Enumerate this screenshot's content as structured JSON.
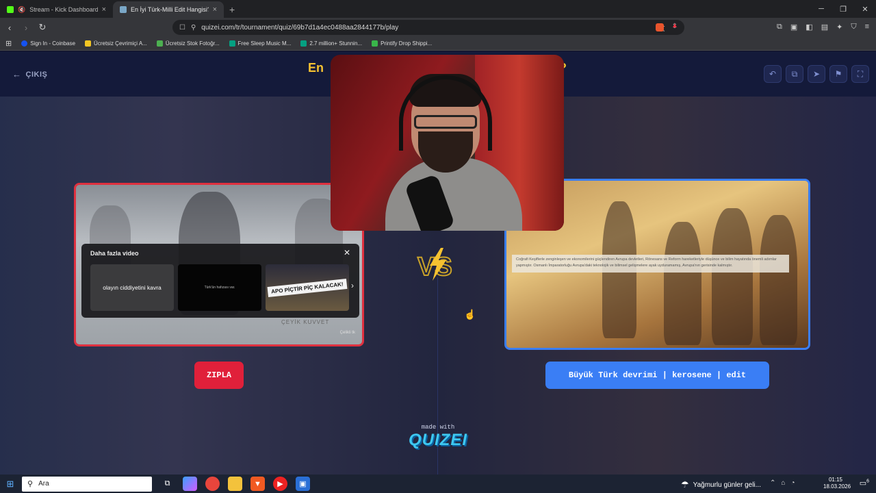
{
  "browser": {
    "tabs": [
      {
        "title": "Stream - Kick Dashboard",
        "favicon_color": "#53fc18"
      },
      {
        "title": "En İyi Türk-Milli Edit Hangisi? - T",
        "favicon_color": "#7aa7c7"
      }
    ],
    "url": "quizei.com/tr/tournament/quiz/69b7d1a4ec0488aa2844177b/play",
    "bookmarks": [
      {
        "label": "Sign In - Coinbase",
        "color": "#1652f0"
      },
      {
        "label": "Ücretsiz Çevrimiçi A...",
        "color": "#f3c623"
      },
      {
        "label": "Ücretsiz Stok Fotoğr...",
        "color": "#4cb050"
      },
      {
        "label": "Free Sleep Music M...",
        "color": "#05a081"
      },
      {
        "label": "2.7 million+ Stunnin...",
        "color": "#05a081"
      },
      {
        "label": "Printify Drop Shippi...",
        "color": "#39b54a"
      }
    ]
  },
  "page": {
    "exit_label": "ÇIKIŞ",
    "title_start": "En",
    "title_end": "?",
    "left_card": {
      "more_videos_title": "Daha fazla video",
      "thumbs": [
        "olayın ciddiyetini kavra",
        "Türk'ün hafızası var.",
        "APO PİÇTİR PİÇ KALACAK!"
      ],
      "bottom_text": "ÇEYİK KUVVET",
      "watermark": "Çelikli tk"
    },
    "right_card": {
      "subtitle": "Coğrafi Keşiflerle zenginleşen ve ekonomilerini güçlendiren Avrupa devletleri, Rönesans ve Reform hareketleriyle düşünce ve bilim hayatında önemli adımlar yapmıştır. Osmanlı İmparatorluğu Avrupa'daki teknolojik ve bilimsel gelişmelere ayak uyduramamış, Avrupa'nın gerisinde kalmıştır."
    },
    "skip_label": "ZIPLA",
    "pick_label": "Büyük Türk devrimi | kerosene | edit",
    "made_with": "made with",
    "brand": "QUIZEI",
    "colors": {
      "accent_red": "#e0203a",
      "accent_blue": "#3a7ef5",
      "title_gold": "#f5c231"
    }
  },
  "taskbar": {
    "search_placeholder": "Ara",
    "weather": "Yağmurlu günler geli...",
    "time": "01:15",
    "date": "18.03.2026",
    "notifications": "6"
  }
}
